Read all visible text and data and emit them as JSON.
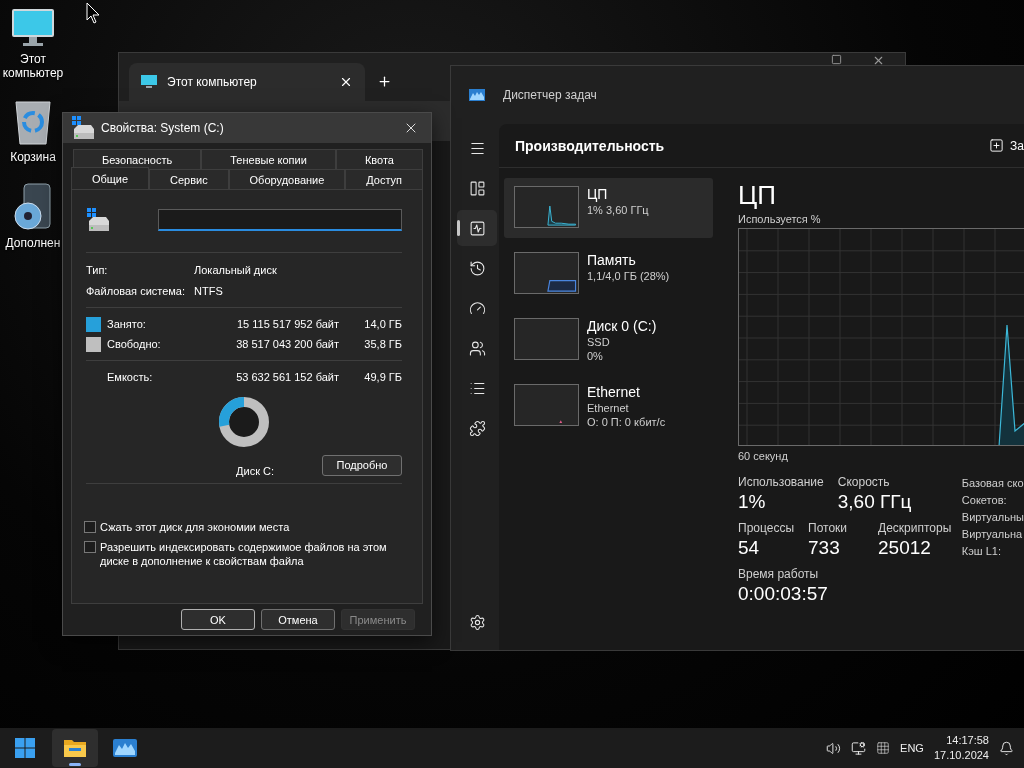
{
  "desktop": {
    "icons": [
      {
        "kind": "computer",
        "label": "Этот компьютер"
      },
      {
        "kind": "recycle-bin",
        "label": "Корзина"
      },
      {
        "kind": "installer",
        "label": "Дополнен"
      }
    ]
  },
  "explorer": {
    "tabs": [
      {
        "title": "Этот компьютер",
        "selected": true
      }
    ]
  },
  "task_manager": {
    "title": "Диспетчер задач",
    "nav": [
      {
        "kind": "menu",
        "selected": false
      },
      {
        "kind": "processes",
        "selected": false
      },
      {
        "kind": "performance",
        "selected": true
      },
      {
        "kind": "history",
        "selected": false
      },
      {
        "kind": "startup",
        "selected": false
      },
      {
        "kind": "users",
        "selected": false
      },
      {
        "kind": "details",
        "selected": false
      },
      {
        "kind": "services",
        "selected": false
      }
    ],
    "footer_nav": [
      {
        "kind": "settings",
        "selected": false
      }
    ],
    "page_title": "Производительность",
    "toolbar_button": "За",
    "resources": [
      {
        "kind": "cpu",
        "name": "ЦП",
        "lines": [
          "1% 3,60 ГГц"
        ],
        "selected": true
      },
      {
        "kind": "memory",
        "name": "Память",
        "lines": [
          "1,1/4,0 ГБ (28%)"
        ],
        "selected": false
      },
      {
        "kind": "disk",
        "name": "Диск 0 (C:)",
        "lines": [
          "SSD",
          "0%"
        ],
        "selected": false
      },
      {
        "kind": "network",
        "name": "Ethernet",
        "lines": [
          "Ethernet",
          "О: 0 П: 0 кбит/с"
        ],
        "selected": false
      }
    ],
    "detail": {
      "title": "ЦП",
      "chart_label": "Используется %",
      "time_label": "60 секунд",
      "stats": [
        [
          {
            "label": "Использование",
            "value": "1%"
          },
          {
            "label": "Скорость",
            "value": "3,60 ГГц"
          }
        ],
        [
          {
            "label": "Процессы",
            "value": "54"
          },
          {
            "label": "Потоки",
            "value": "733"
          },
          {
            "label": "Дескрипторы",
            "value": "25012"
          }
        ],
        [
          {
            "label": "Время работы",
            "value": "0:00:03:57"
          }
        ]
      ],
      "specs": [
        "Базовая ско",
        "Сокетов:",
        "Виртуальны",
        "Виртуальна",
        "Кэш L1:"
      ]
    }
  },
  "properties_dialog": {
    "title": "Свойства: System (C:)",
    "tab_rows": [
      [
        {
          "label": "Безопасность",
          "selected": false
        },
        {
          "label": "Теневые копии",
          "selected": false
        },
        {
          "label": "Квота",
          "selected": false
        }
      ],
      [
        {
          "label": "Общие",
          "selected": true
        },
        {
          "label": "Сервис",
          "selected": false
        },
        {
          "label": "Оборудование",
          "selected": false
        },
        {
          "label": "Доступ",
          "selected": false
        }
      ]
    ],
    "info": [
      {
        "label": "Тип:",
        "value": "Локальный диск"
      },
      {
        "label": "Файловая система:",
        "value": "NTFS"
      }
    ],
    "space": [
      {
        "label": "Занято:",
        "bytes": "15 115 517 952 байт",
        "size": "14,0 ГБ",
        "color": "#26a0da"
      },
      {
        "label": "Свободно:",
        "bytes": "38 517 043 200 байт",
        "size": "35,8 ГБ",
        "color": "#bfbfbf"
      }
    ],
    "capacity": {
      "label": "Емкость:",
      "bytes": "53 632 561 152 байт",
      "size": "49,9 ГБ"
    },
    "usage_chart": {
      "level": 0.28
    },
    "drive_label": "Диск C:",
    "details_button": "Подробно",
    "options": [
      {
        "label": "Сжать этот диск для экономии места",
        "checked": false
      },
      {
        "label": "Разрешить индексировать содержимое файлов на этом диске в дополнение к свойствам файла",
        "checked": false
      }
    ],
    "buttons": [
      {
        "label": "OK",
        "default": true,
        "disabled": false
      },
      {
        "label": "Отмена",
        "default": false,
        "disabled": false
      },
      {
        "label": "Применить",
        "default": false,
        "disabled": true
      }
    ]
  },
  "taskbar": {
    "apps": [
      {
        "kind": "start",
        "selected": false
      },
      {
        "kind": "explorer",
        "selected": true
      },
      {
        "kind": "task-manager",
        "selected": false
      }
    ],
    "tray": {
      "language": "ENG",
      "time": "14:17:58",
      "date": "17.10.2024"
    }
  }
}
